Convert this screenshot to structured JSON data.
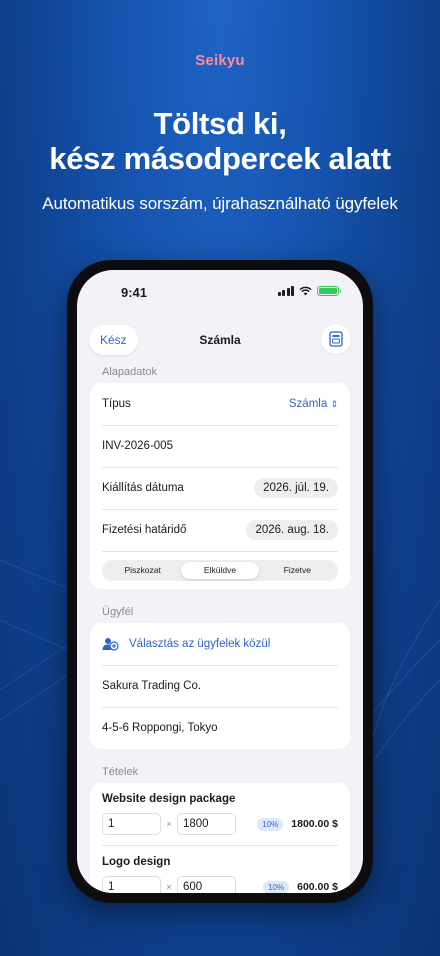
{
  "brand": "Seikyu",
  "headline_1": "Töltsd ki,",
  "headline_2": "kész másodpercek alatt",
  "subheadline": "Automatikus sorszám, újrahasználható ügyfelek",
  "status": {
    "time": "9:41"
  },
  "nav": {
    "done": "Kész",
    "title": "Számla",
    "preview_icon": "document-preview-icon"
  },
  "basics": {
    "header": "Alapadatok",
    "type_label": "Típus",
    "type_value": "Számla",
    "invoice_number": "INV-2026-005",
    "issue_label": "Kiállítás dátuma",
    "issue_date": "2026. júl. 19.",
    "due_label": "Fizetési határidő",
    "due_date": "2026. aug. 18.",
    "status_segments": [
      "Piszkozat",
      "Elküldve",
      "Fizetve"
    ],
    "status_selected": "Elküldve"
  },
  "client": {
    "header": "Ügyfél",
    "choose": "Választás az ügyfelek közül",
    "name": "Sakura Trading Co.",
    "address": "4-5-6 Roppongi, Tokyo"
  },
  "items": {
    "header": "Tételek",
    "list": [
      {
        "title": "Website design package",
        "qty": "1",
        "price": "1800",
        "tax": "10%",
        "amount": "1800.00 $"
      },
      {
        "title": "Logo design",
        "qty": "1",
        "price": "600",
        "tax": "10%",
        "amount": "600.00 $"
      }
    ]
  },
  "colors": {
    "accent": "#2f66c6",
    "brand": "#ff8a9a",
    "battery": "#34c759"
  }
}
